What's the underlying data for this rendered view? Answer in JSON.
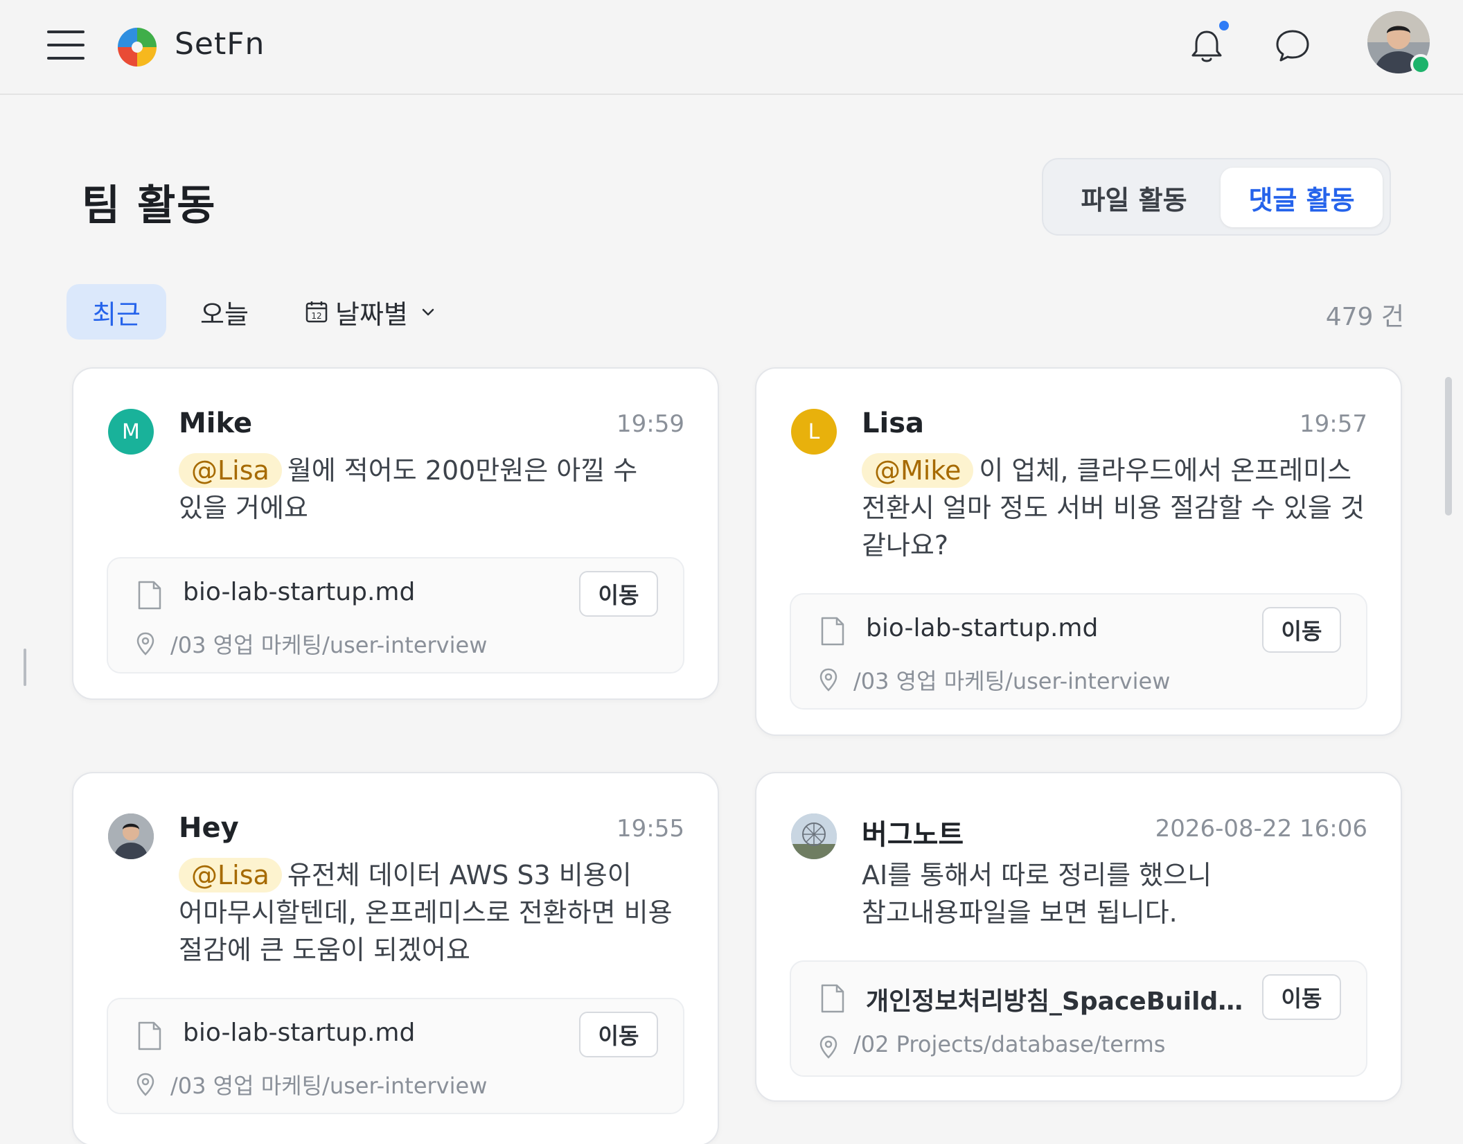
{
  "header": {
    "brand": "SetFn",
    "icons": [
      "menu-icon",
      "logo-icon",
      "bell-icon",
      "chat-icon",
      "avatar"
    ],
    "notification_dot_color": "#2f7cf6",
    "online_color": "#1db36b"
  },
  "page": {
    "title": "팀 활동",
    "tabs": [
      {
        "label": "파일 활동",
        "active": false
      },
      {
        "label": "댓글 활동",
        "active": true
      }
    ]
  },
  "filters": {
    "recent": "최근",
    "today": "오늘",
    "by_date": "날짜별",
    "count": "479 건"
  },
  "colors": {
    "accent": "#2563eb",
    "mention_bg": "#fdf3cf",
    "mention_text": "#a66a00"
  },
  "cards": [
    {
      "user": "Mike",
      "initial": "M",
      "avatar_color": "#19b29a",
      "time": "19:59",
      "mention": "@Lisa",
      "message": "월에 적어도 200만원은 아낄 수 있을 거에요",
      "file": "bio-lab-startup.md",
      "path": "/03 영업 마케팅/user-interview",
      "action": "이동"
    },
    {
      "user": "Lisa",
      "initial": "L",
      "avatar_color": "#e8b10c",
      "time": "19:57",
      "mention": "@Mike",
      "message": "이 업체, 클라우드에서 온프레미스 전환시 얼마 정도 서버 비용 절감할 수 있을 것 같나요?",
      "file": "bio-lab-startup.md",
      "path": "/03 영업 마케팅/user-interview",
      "action": "이동"
    },
    {
      "user": "Hey",
      "time": "19:55",
      "mention": "@Lisa",
      "message": "유전체 데이터 AWS S3 비용이 어마무시할텐데, 온프레미스로 전환하면 비용 절감에 큰 도움이 되겠어요",
      "file": "bio-lab-startup.md",
      "path": "/03 영업 마케팅/user-interview",
      "action": "이동"
    },
    {
      "user": "버그노트",
      "time": "2026-08-22 16:06",
      "mention": "",
      "message": "AI를 통해서 따로 정리를 했으니 참고내용파일을 보면 됩니다.",
      "file": "개인정보처리방침_SpaceBuilder-...",
      "path": "/02 Projects/database/terms",
      "action": "이동"
    }
  ]
}
